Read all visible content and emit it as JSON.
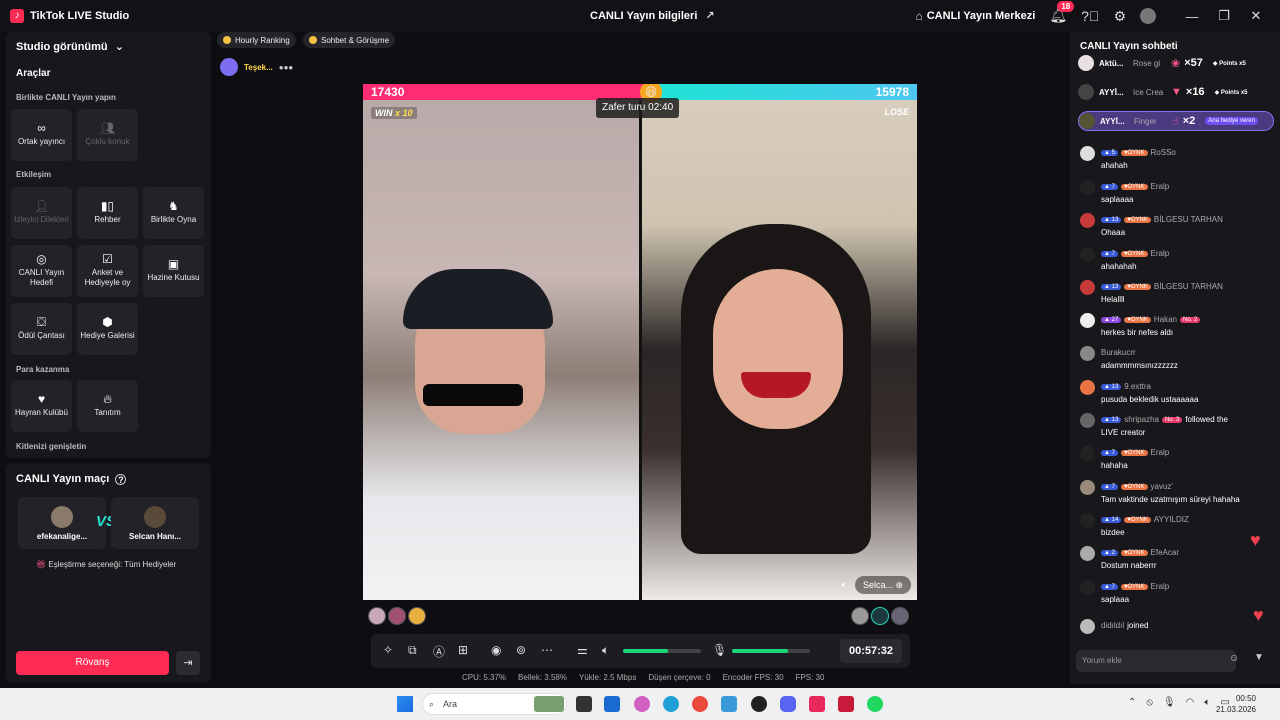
{
  "titlebar": {
    "app_title": "TikTok LIVE Studio",
    "center_title": "CANLI Yayın bilgileri",
    "live_center": "CANLI Yayın Merkezi",
    "notification_count": "18"
  },
  "left": {
    "studio_view": "Studio görünümü",
    "tools_title": "Araçlar",
    "section_collab": "Birlikte CANLI Yayın yapın",
    "section_engage": "Etkileşim",
    "section_money": "Para kazanma",
    "section_audience": "Kitlenizi genişletin",
    "collab_tiles": [
      {
        "label": "Ortak yayıncı",
        "icon": "link-icon"
      },
      {
        "label": "Çoklu konuk",
        "icon": "people-icon"
      }
    ],
    "engage_tiles": [
      {
        "label": "İzleyici Dilekleri",
        "icon": "wish-icon"
      },
      {
        "label": "Rehber",
        "icon": "book-icon"
      },
      {
        "label": "Birlikte Oyna",
        "icon": "game-icon"
      },
      {
        "label": "CANLI Yayın Hedefi",
        "icon": "target-icon"
      },
      {
        "label": "Anket ve Hediyeyle oy",
        "icon": "poll-icon"
      },
      {
        "label": "Hazine Kutusu",
        "icon": "chest-icon"
      },
      {
        "label": "Ödül Çantası",
        "icon": "bag-icon"
      },
      {
        "label": "Hediye Galerisi",
        "icon": "gallery-icon"
      }
    ],
    "money_tiles": [
      {
        "label": "Hayran Kulübü",
        "icon": "heart-icon"
      },
      {
        "label": "Tanıtım",
        "icon": "flame-icon"
      }
    ]
  },
  "match": {
    "title": "CANLI Yayın maçı",
    "opponent_left": "efekanalige...",
    "opponent_right": "Selcan Hanı...",
    "vs": "VS",
    "pairing": "Eşleştirme seçeneği: Tüm Hediyeler",
    "rematch": "Rövanş"
  },
  "chips": {
    "hourly": "Hourly Ranking",
    "chat": "Sohbet & Görüşme",
    "thanks": "Teşek..."
  },
  "battle": {
    "score_left": "17430",
    "score_right": "15978",
    "win_label": "WIN",
    "win_mult": "x 10",
    "lose_label": "LOSE",
    "timer": "Zafer turu 02:40",
    "guest_name": "Selca..."
  },
  "controls": {
    "clock": "00:57:32",
    "volume_level": 0.58,
    "mic_level": 0.72
  },
  "stats": {
    "cpu": "CPU:  5.37%",
    "memory": "Bellek:  3.58%",
    "upload": "Yükle:  2.5 Mbps",
    "dropped": "Düşen çerçeve:  0",
    "encoder_fps": "Encoder FPS:  30",
    "fps": "FPS:  30"
  },
  "chat": {
    "title": "CANLI Yayın sohbeti",
    "gifts": [
      {
        "user": "Aktü...",
        "item": "Rose gi",
        "count": "×57",
        "points": "Points x5"
      },
      {
        "user": "AYYİ...",
        "item": "Ice Crea",
        "count": "×16",
        "points": "Points x5"
      },
      {
        "user": "AYYİ...",
        "item": "Finger",
        "count": "×2",
        "badge": "Ana hediye veren"
      }
    ],
    "messages": [
      {
        "level": "5",
        "tag": "OYNK",
        "user": "RoSSo",
        "text": "ahahah"
      },
      {
        "level": "7",
        "tag": "OYNK",
        "user": "Eralp",
        "text": "saplaaaa"
      },
      {
        "level": "13",
        "tag": "OYNK",
        "user": "BİLGESU TARHAN",
        "text": "Ohaaa"
      },
      {
        "level": "7",
        "tag": "OYNK",
        "user": "Eralp",
        "text": "ahahahah"
      },
      {
        "level": "13",
        "tag": "OYNK",
        "user": "BİLGESU TARHAN",
        "text": "Helallll"
      },
      {
        "level": "27",
        "tag": "OYNK",
        "user": "Hakan",
        "no": "No. 2",
        "text": "herkes bir nefes aldı"
      },
      {
        "user": "Burakucrr",
        "text": "adammmmsınızzzzzz"
      },
      {
        "level": "13",
        "user": "9.exttra",
        "text": "pusuda bekledik ustaaaaaa"
      },
      {
        "user": "shripazha",
        "level": "13",
        "no": "No. 3",
        "extra": "followed the",
        "text": "LIVE creator"
      },
      {
        "level": "7",
        "tag": "OYNK",
        "user": "Eralp",
        "text": "hahaha"
      },
      {
        "level": "7",
        "tag": "OYNK",
        "user": "yavuz'",
        "text": "Tam vaktinde uzatmışım süreyi hahaha"
      },
      {
        "level": "14",
        "tag": "OYNK",
        "user": "AYYILDIZ",
        "text": "bizdee"
      },
      {
        "level": "2",
        "tag": "OYNK",
        "user": "EfeAcar",
        "text": "Dostum naberrr"
      },
      {
        "level": "7",
        "tag": "OYNK",
        "user": "Eralp",
        "text": "saplaaa"
      }
    ],
    "joined_user": "didıldıl",
    "joined_text": "joined",
    "input_placeholder": "Yorum ekle"
  },
  "taskbar": {
    "search": "Ara",
    "time": "00:50",
    "date": "21.03.2026"
  }
}
